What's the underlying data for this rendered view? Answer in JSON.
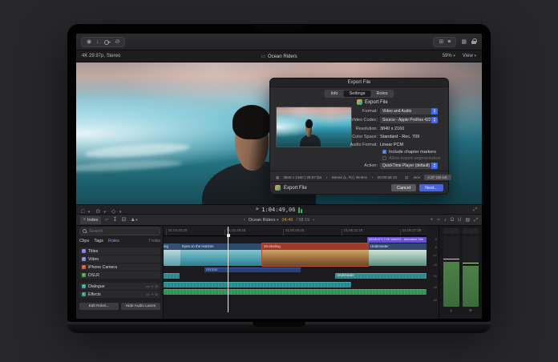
{
  "top_toolbar": {
    "left_icon_names": [
      "record-icon",
      "import-media-icon",
      "keyword-editor-icon",
      "background-tasks-icon"
    ],
    "right_icon_names": [
      "grid-view-icon",
      "list-view-icon",
      "browser-icon",
      "lock-icon"
    ]
  },
  "viewer_bar": {
    "format_info": "4K 29.97p, Stereo",
    "project_title": "Ocean Riders",
    "zoom_level": "59%",
    "view_label": "View"
  },
  "export_dialog": {
    "window_title": "Export File",
    "tabs": [
      {
        "label": "Info",
        "active": false
      },
      {
        "label": "Settings",
        "active": true
      },
      {
        "label": "Roles",
        "active": false
      }
    ],
    "header_title": "Export File",
    "fields": [
      {
        "label": "Format:",
        "value": "Video and Audio",
        "type": "dropdown"
      },
      {
        "label": "Video Codec:",
        "value": "Source - Apple ProRes 422",
        "type": "dropdown"
      },
      {
        "label": "Resolution:",
        "value": "3840 x 2160",
        "type": "static"
      },
      {
        "label": "Color Space:",
        "value": "Standard - Rec. 709",
        "type": "static"
      },
      {
        "label": "Audio Format:",
        "value": "Linear PCM",
        "type": "static"
      }
    ],
    "checkboxes": [
      {
        "label": "Include chapter markers",
        "checked": true
      },
      {
        "label": "Allow export segmentation",
        "checked": false
      }
    ],
    "action_field": {
      "label": "Action:",
      "value": "QuickTime Player (default)"
    },
    "summary": {
      "video_info": "3840 x 2160 | 29.97 fps",
      "audio_info": "Stereo (L, R) | 48 kHz",
      "duration": "00:00:58:19",
      "file_type": ".mov",
      "size_estimate": "4.37 GB est."
    },
    "footer": {
      "label": "Export File",
      "cancel_label": "Cancel",
      "next_label": "Next..."
    }
  },
  "timeline": {
    "transport": {
      "timecode": "1:04:49,06"
    },
    "nav": {
      "index_label": "Index",
      "project": "Ocean Riders",
      "elapsed": "04:49",
      "separator": "/",
      "duration": "58:19"
    },
    "index_panel": {
      "search_placeholder": "Search",
      "tabs": [
        {
          "label": "Clips",
          "active": false
        },
        {
          "label": "Tags",
          "active": false
        },
        {
          "label": "Roles",
          "active": true
        }
      ],
      "count_label": "7 roles",
      "roles": [
        {
          "name": "Titles",
          "color": "#8a7ae0",
          "audio": false
        },
        {
          "name": "Video",
          "color": "#7a8ae0",
          "audio": false
        },
        {
          "name": "iPhone Camera",
          "color": "#d0593a",
          "audio": false
        },
        {
          "name": "DSLR",
          "color": "#4aa04a",
          "audio": false
        },
        {
          "name": "Dialogue",
          "color": "#3aa69a",
          "audio": true
        },
        {
          "name": "Effects",
          "color": "#3aa67a",
          "audio": true
        }
      ],
      "edit_roles_label": "Edit Roles...",
      "hide_audio_label": "Hide Audio Lanes"
    },
    "ruler_ticks": [
      "01:04:33:29",
      "01:04:49:29",
      "01:05:05:29",
      "01:05:21:29",
      "01:05:37:29"
    ],
    "title_clip": {
      "name": "BENEATH THE WAVES - Animated Title",
      "color": "#6b4fd0"
    },
    "video_clips": [
      {
        "name": "Surfing"
      },
      {
        "name": "Eyes on the Horizon"
      },
      {
        "name": "Snorkeling"
      },
      {
        "name": "Underwater"
      }
    ],
    "connected_bars": {
      "horizon_label": "Horizon",
      "underwater_label": "Underwater"
    },
    "meters": {
      "db_ticks": [
        "0",
        "-6",
        "-12",
        "-20",
        "-30",
        "-40",
        "-60"
      ],
      "channel_labels": [
        "L",
        "R"
      ]
    }
  },
  "colors": {
    "accent_blue": "#3f6af5",
    "timeline_orange": "#d89a3e",
    "clip_header_blue": "#2f4a6e",
    "clip_header_red": "#a03a28",
    "audio_teal": "#28898c",
    "audio_green": "#2c9450"
  }
}
